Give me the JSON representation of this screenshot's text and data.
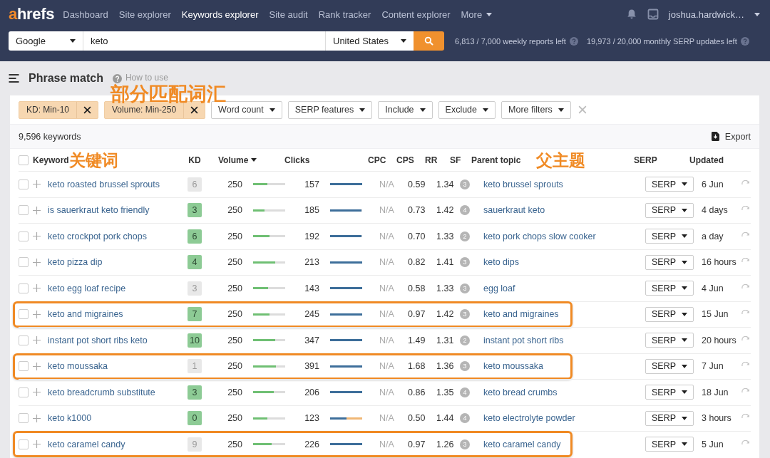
{
  "top_nav": {
    "logo": "ahrefs",
    "items": [
      {
        "label": "Dashboard",
        "selected": false
      },
      {
        "label": "Site explorer",
        "selected": false
      },
      {
        "label": "Keywords explorer",
        "selected": true
      },
      {
        "label": "Site audit",
        "selected": false
      },
      {
        "label": "Rank tracker",
        "selected": false
      },
      {
        "label": "Content explorer",
        "selected": false
      }
    ],
    "more": "More",
    "user": "joshua.hardwick…"
  },
  "search_bar": {
    "engine": "Google",
    "query": "keto",
    "country": "United States",
    "quotas": [
      "6,813 / 7,000 weekly reports left",
      "19,973 / 20,000 monthly SERP updates left"
    ]
  },
  "page_header": {
    "title": "Phrase match",
    "help_link": "How to use",
    "annotation": "部分匹配词汇"
  },
  "filters": [
    {
      "kind": "applied",
      "label": "KD: Min-10"
    },
    {
      "kind": "applied",
      "label": "Volume: Min-250"
    },
    {
      "kind": "dropdown",
      "label": "Word count"
    },
    {
      "kind": "dropdown",
      "label": "SERP features"
    },
    {
      "kind": "dropdown",
      "label": "Include"
    },
    {
      "kind": "dropdown",
      "label": "Exclude"
    },
    {
      "kind": "dropdown",
      "label": "More filters"
    }
  ],
  "results": {
    "count": "9,596 keywords",
    "export": "Export"
  },
  "table": {
    "select_all_checked": false,
    "columns": [
      {
        "label": "Keyword",
        "sorted": false,
        "annotation": "关键词"
      },
      {
        "label": "KD",
        "sorted": false
      },
      {
        "label": "Volume",
        "sorted": true
      },
      {
        "label": "Clicks",
        "sorted": false
      },
      {
        "label": "CPC",
        "sorted": false
      },
      {
        "label": "CPS",
        "sorted": false
      },
      {
        "label": "RR",
        "sorted": false
      },
      {
        "label": "SF",
        "sorted": false
      },
      {
        "label": "Parent topic",
        "sorted": false,
        "annotation": "父主题"
      },
      {
        "label": "SERP",
        "sorted": false
      },
      {
        "label": "Updated",
        "sorted": false
      }
    ],
    "rows": [
      {
        "checked": false,
        "highlighted": false,
        "keyword": "keto roasted brussel sprouts",
        "kd": {
          "value": "6",
          "color": "#e8e8e8"
        },
        "volume": "250",
        "volume_bar": {
          "level": 0.45
        },
        "clicks": "157",
        "clicks_bar": [
          {
            "level": 1.0,
            "color": "#3d6e9a"
          }
        ],
        "cpc": "N/A",
        "cps": "0.59",
        "rr": "1.34",
        "sf": "3",
        "parent_topic": "keto brussel sprouts",
        "serp": "SERP",
        "updated": "6 Jun"
      },
      {
        "checked": false,
        "highlighted": false,
        "keyword": "is sauerkraut keto friendly",
        "kd": {
          "value": "3",
          "color": "#8dcb95"
        },
        "volume": "250",
        "volume_bar": {
          "level": 0.36
        },
        "clicks": "185",
        "clicks_bar": [
          {
            "level": 0.97,
            "color": "#3d6e9a"
          }
        ],
        "cpc": "N/A",
        "cps": "0.73",
        "rr": "1.42",
        "sf": "4",
        "parent_topic": "sauerkraut keto",
        "serp": "SERP",
        "updated": "4 days"
      },
      {
        "checked": false,
        "highlighted": false,
        "keyword": "keto crockpot pork chops",
        "kd": {
          "value": "6",
          "color": "#8dcb95"
        },
        "volume": "250",
        "volume_bar": {
          "level": 0.5
        },
        "clicks": "192",
        "clicks_bar": [
          {
            "level": 0.97,
            "color": "#3d6e9a"
          }
        ],
        "cpc": "N/A",
        "cps": "0.70",
        "rr": "1.33",
        "sf": "2",
        "parent_topic": "keto pork chops slow cooker",
        "serp": "SERP",
        "updated": "a day"
      },
      {
        "checked": false,
        "highlighted": false,
        "keyword": "keto pizza dip",
        "kd": {
          "value": "4",
          "color": "#8dcb95"
        },
        "volume": "250",
        "volume_bar": {
          "level": 0.68
        },
        "clicks": "213",
        "clicks_bar": [
          {
            "level": 1.0,
            "color": "#3d6e9a"
          }
        ],
        "cpc": "N/A",
        "cps": "0.82",
        "rr": "1.41",
        "sf": "3",
        "parent_topic": "keto dips",
        "serp": "SERP",
        "updated": "16 hours"
      },
      {
        "checked": false,
        "highlighted": false,
        "keyword": "keto egg loaf recipe",
        "kd": {
          "value": "3",
          "color": "#e8e8e8"
        },
        "volume": "250",
        "volume_bar": {
          "level": 0.47
        },
        "clicks": "143",
        "clicks_bar": [
          {
            "level": 1.0,
            "color": "#3d6e9a"
          }
        ],
        "cpc": "N/A",
        "cps": "0.58",
        "rr": "1.33",
        "sf": "3",
        "parent_topic": "egg loaf",
        "serp": "SERP",
        "updated": "4 Jun"
      },
      {
        "checked": false,
        "highlighted": true,
        "keyword": "keto and migraines",
        "kd": {
          "value": "7",
          "color": "#8dcb95"
        },
        "volume": "250",
        "volume_bar": {
          "level": 0.5
        },
        "clicks": "245",
        "clicks_bar": [
          {
            "level": 1.0,
            "color": "#3d6e9a"
          }
        ],
        "cpc": "N/A",
        "cps": "0.97",
        "rr": "1.42",
        "sf": "3",
        "parent_topic": "keto and migraines",
        "serp": "SERP",
        "updated": "15 Jun"
      },
      {
        "checked": false,
        "highlighted": false,
        "keyword": "instant pot short ribs keto",
        "kd": {
          "value": "10",
          "color": "#8dcb95"
        },
        "volume": "250",
        "volume_bar": {
          "level": 0.68
        },
        "clicks": "347",
        "clicks_bar": [
          {
            "level": 1.0,
            "color": "#3d6e9a"
          }
        ],
        "cpc": "N/A",
        "cps": "1.49",
        "rr": "1.31",
        "sf": "2",
        "parent_topic": "instant pot short ribs",
        "serp": "SERP",
        "updated": "20 hours"
      },
      {
        "checked": false,
        "highlighted": true,
        "keyword": "keto moussaka",
        "kd": {
          "value": "1",
          "color": "#e8e8e8"
        },
        "volume": "250",
        "volume_bar": {
          "level": 0.72
        },
        "clicks": "391",
        "clicks_bar": [
          {
            "level": 1.0,
            "color": "#3d6e9a"
          }
        ],
        "cpc": "N/A",
        "cps": "1.68",
        "rr": "1.36",
        "sf": "3",
        "parent_topic": "keto moussaka",
        "serp": "SERP",
        "updated": "7 Jun"
      },
      {
        "checked": false,
        "highlighted": false,
        "keyword": "keto breadcrumb substitute",
        "kd": {
          "value": "3",
          "color": "#8dcb95"
        },
        "volume": "250",
        "volume_bar": {
          "level": 0.64
        },
        "clicks": "206",
        "clicks_bar": [
          {
            "level": 1.0,
            "color": "#3d6e9a"
          }
        ],
        "cpc": "N/A",
        "cps": "0.86",
        "rr": "1.35",
        "sf": "4",
        "parent_topic": "keto bread crumbs",
        "serp": "SERP",
        "updated": "18 Jun"
      },
      {
        "checked": false,
        "highlighted": false,
        "keyword": "keto k1000",
        "kd": {
          "value": "0",
          "color": "#8dcb95"
        },
        "volume": "250",
        "volume_bar": {
          "level": 0.45
        },
        "clicks": "123",
        "clicks_bar": [
          {
            "level": 0.52,
            "color": "#3d6e9a"
          },
          {
            "level": 0.48,
            "color": "#f0b775"
          }
        ],
        "cpc": "N/A",
        "cps": "0.50",
        "rr": "1.44",
        "sf": "4",
        "parent_topic": "keto electrolyte powder",
        "serp": "SERP",
        "updated": "3 hours"
      },
      {
        "checked": false,
        "highlighted": true,
        "keyword": "keto caramel candy",
        "kd": {
          "value": "9",
          "color": "#e8e8e8"
        },
        "volume": "250",
        "volume_bar": {
          "level": 0.58
        },
        "clicks": "226",
        "clicks_bar": [
          {
            "level": 1.0,
            "color": "#3d6e9a"
          }
        ],
        "cpc": "N/A",
        "cps": "0.97",
        "rr": "1.26",
        "sf": "3",
        "parent_topic": "keto caramel candy",
        "serp": "SERP",
        "updated": "5 Jun"
      }
    ]
  }
}
